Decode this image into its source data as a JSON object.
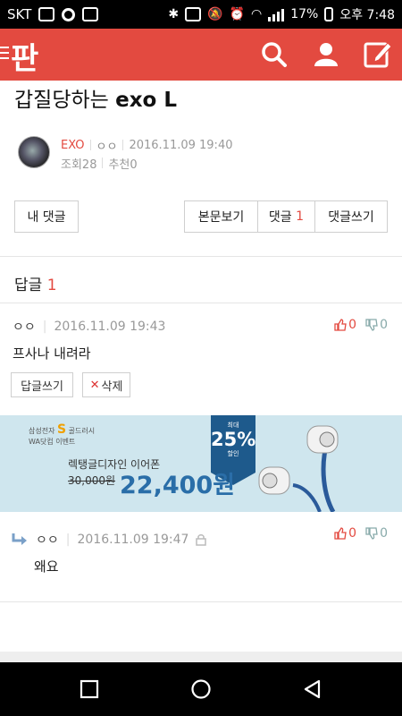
{
  "status_bar": {
    "carrier": "SKT",
    "battery": "17%",
    "time": "오후 7:48"
  },
  "header": {
    "logo": "판",
    "icons": [
      "menu-icon",
      "search-icon",
      "user-icon",
      "compose-icon"
    ]
  },
  "post": {
    "title_prefix": "갑질당하는 ",
    "title_bold": "exo L",
    "author_tag": "EXO",
    "author_name": "ㅇㅇ",
    "date": "2016.11.09 19:40",
    "views": "조회28",
    "recommends": "추천0"
  },
  "buttons": {
    "my_comments": "내 댓글",
    "view_post": "본문보기",
    "comments_label": "댓글",
    "comments_count": "1",
    "write_comment": "댓글쓰기"
  },
  "replies": {
    "label": "답글",
    "count": "1"
  },
  "comments": [
    {
      "author": "ㅇㅇ",
      "date": "2016.11.09 19:43",
      "text": "프사나 내려라",
      "up": "0",
      "down": "0",
      "reply_button": "답글쓰기",
      "delete_button": "삭제"
    },
    {
      "author": "ㅇㅇ",
      "date": "2016.11.09 19:47",
      "text": "왜요",
      "up": "0",
      "down": "0"
    }
  ],
  "ad": {
    "brand_line1": "삼성전자",
    "brand_s": "S",
    "brand_line1b": "골드러시",
    "brand_line2": "WA닷컴 이벤트",
    "badge_top": "최대",
    "badge_pct": "25%",
    "badge_bottom": "할인",
    "product": "렉탱글디자인 이어폰",
    "old_price": "30,000원",
    "new_price": "22,400원"
  },
  "colors": {
    "brand_red": "#e34a40",
    "ad_bg": "#cfe6ee",
    "ad_blue": "#2a6ea8"
  }
}
